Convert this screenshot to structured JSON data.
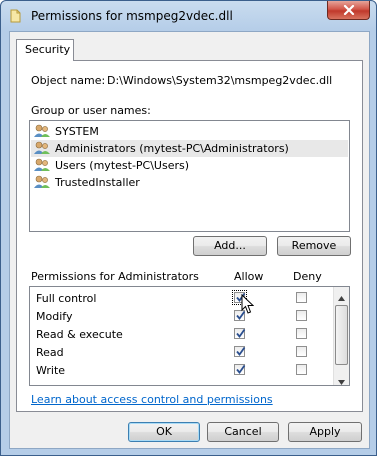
{
  "window": {
    "title": "Permissions for msmpeg2vdec.dll"
  },
  "tabs": [
    {
      "label": "Security"
    }
  ],
  "object": {
    "label": "Object name:",
    "value": "D:\\Windows\\System32\\msmpeg2vdec.dll"
  },
  "groups": {
    "label": "Group or user names:",
    "items": [
      {
        "name": "SYSTEM",
        "selected": false
      },
      {
        "name": "Administrators (mytest-PC\\Administrators)",
        "selected": true
      },
      {
        "name": "Users (mytest-PC\\Users)",
        "selected": false
      },
      {
        "name": "TrustedInstaller",
        "selected": false
      }
    ]
  },
  "buttons": {
    "add": "Add...",
    "remove": "Remove",
    "ok": "OK",
    "cancel": "Cancel",
    "apply": "Apply"
  },
  "permissions": {
    "label": "Permissions for Administrators",
    "allow_header": "Allow",
    "deny_header": "Deny",
    "rows": [
      {
        "name": "Full control",
        "allow": true,
        "deny": false
      },
      {
        "name": "Modify",
        "allow": true,
        "deny": false
      },
      {
        "name": "Read & execute",
        "allow": true,
        "deny": false
      },
      {
        "name": "Read",
        "allow": true,
        "deny": false
      },
      {
        "name": "Write",
        "allow": true,
        "deny": false
      }
    ]
  },
  "help_link": "Learn about access control and permissions",
  "colors": {
    "link": "#0066cc",
    "selection": "#e8e8e8",
    "close_button": "#c0392b"
  }
}
